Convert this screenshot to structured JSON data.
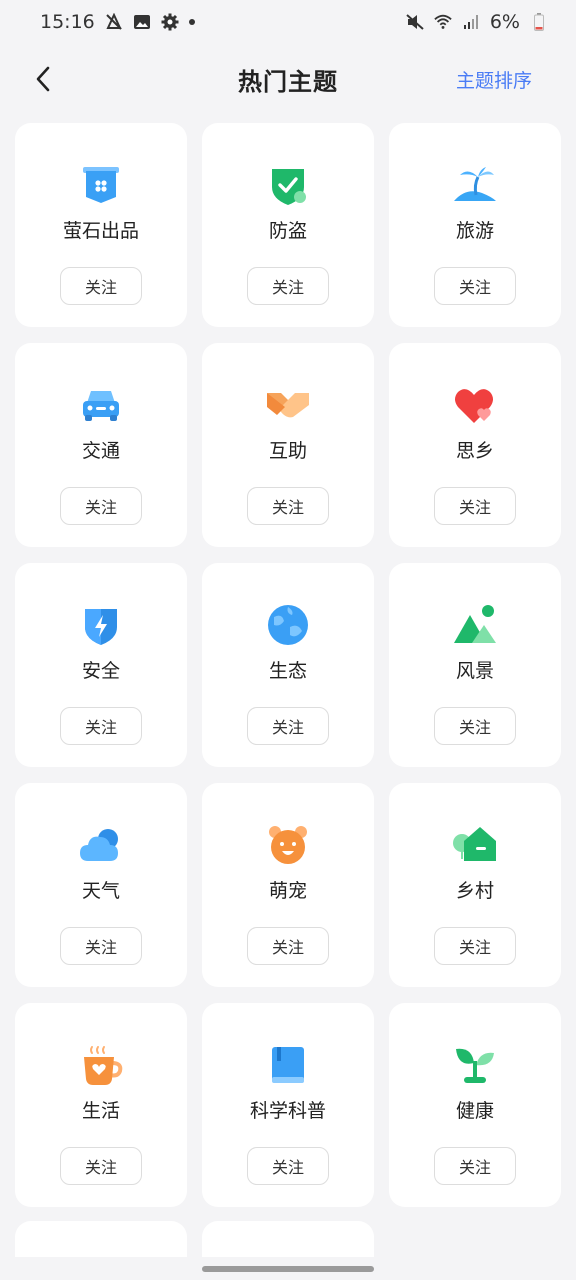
{
  "status": {
    "time": "15:16",
    "battery": "6%"
  },
  "header": {
    "title": "热门主题",
    "sort_label": "主题排序"
  },
  "topics": [
    {
      "name": "萤石出品",
      "icon": "banner-icon",
      "follow": "关注"
    },
    {
      "name": "防盗",
      "icon": "shield-check-icon",
      "follow": "关注"
    },
    {
      "name": "旅游",
      "icon": "palm-island-icon",
      "follow": "关注"
    },
    {
      "name": "交通",
      "icon": "car-icon",
      "follow": "关注"
    },
    {
      "name": "互助",
      "icon": "handshake-icon",
      "follow": "关注"
    },
    {
      "name": "思乡",
      "icon": "heart-icon",
      "follow": "关注"
    },
    {
      "name": "安全",
      "icon": "shield-bolt-icon",
      "follow": "关注"
    },
    {
      "name": "生态",
      "icon": "globe-icon",
      "follow": "关注"
    },
    {
      "name": "风景",
      "icon": "mountain-sun-icon",
      "follow": "关注"
    },
    {
      "name": "天气",
      "icon": "cloud-icon",
      "follow": "关注"
    },
    {
      "name": "萌宠",
      "icon": "bear-face-icon",
      "follow": "关注"
    },
    {
      "name": "乡村",
      "icon": "house-tree-icon",
      "follow": "关注"
    },
    {
      "name": "生活",
      "icon": "coffee-cup-icon",
      "follow": "关注"
    },
    {
      "name": "科学科普",
      "icon": "book-icon",
      "follow": "关注"
    },
    {
      "name": "健康",
      "icon": "sprout-icon",
      "follow": "关注"
    }
  ],
  "colors": {
    "accent": "#4a7cf5",
    "background": "#f4f4f6"
  }
}
